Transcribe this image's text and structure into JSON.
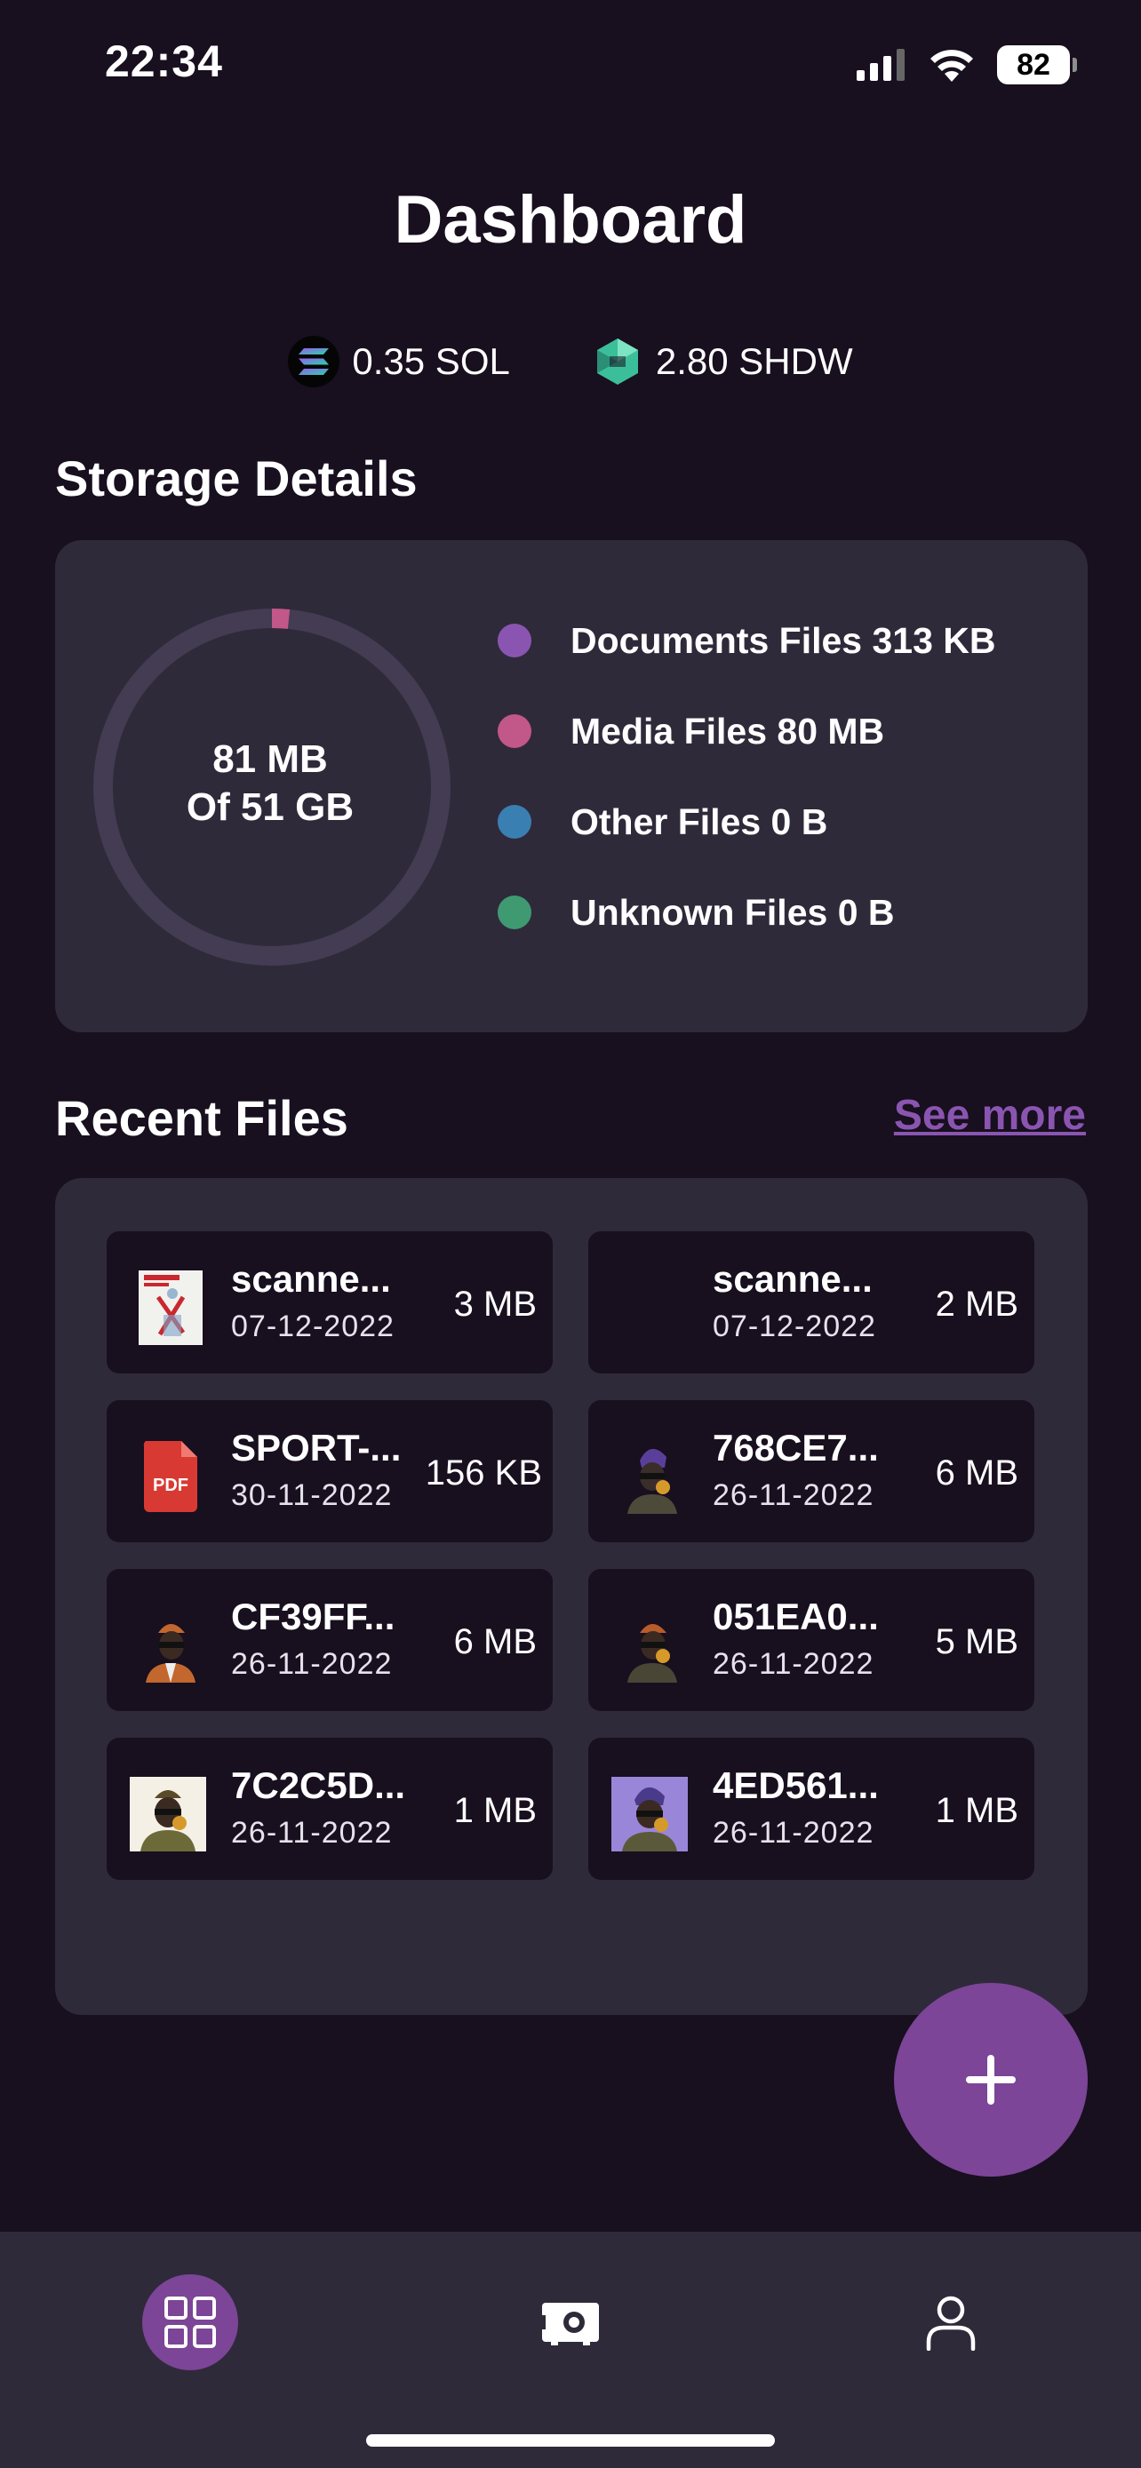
{
  "status_bar": {
    "time": "22:34",
    "battery": "82"
  },
  "header": {
    "title": "Dashboard"
  },
  "balances": [
    {
      "icon": "solana-coin-icon",
      "value": "0.35 SOL"
    },
    {
      "icon": "shadow-token-icon",
      "value": "2.80 SHDW"
    }
  ],
  "storage": {
    "heading": "Storage Details",
    "used": "81 MB",
    "total": "Of 51 GB",
    "used_fraction": 0.0016,
    "legend": [
      {
        "label": "Documents Files 313 KB",
        "color": "#8a55b1"
      },
      {
        "label": "Media Files 80 MB",
        "color": "#c2578a"
      },
      {
        "label": "Other Files 0 B",
        "color": "#3a7fb2"
      },
      {
        "label": "Unknown Files 0 B",
        "color": "#3f9a72"
      }
    ]
  },
  "recent": {
    "heading": "Recent Files",
    "see_more": "See more",
    "files": [
      {
        "name": "scanne...",
        "date": "07-12-2022",
        "size": "3 MB",
        "thumb": "magazine-thumbnail"
      },
      {
        "name": "scanne...",
        "date": "07-12-2022",
        "size": "2 MB",
        "thumb": "none"
      },
      {
        "name": "SPORT-...",
        "date": "30-11-2022",
        "size": "156 KB",
        "thumb": "pdf-icon"
      },
      {
        "name": "768CE7...",
        "date": "26-11-2022",
        "size": "6 MB",
        "thumb": "avatar-thumbnail"
      },
      {
        "name": "CF39FF...",
        "date": "26-11-2022",
        "size": "6 MB",
        "thumb": "avatar-thumbnail"
      },
      {
        "name": "051EA0...",
        "date": "26-11-2022",
        "size": "5 MB",
        "thumb": "avatar-thumbnail"
      },
      {
        "name": "7C2C5D...",
        "date": "26-11-2022",
        "size": "1 MB",
        "thumb": "avatar-thumbnail"
      },
      {
        "name": "4ED561...",
        "date": "26-11-2022",
        "size": "1 MB",
        "thumb": "avatar-thumbnail"
      }
    ]
  },
  "fab": {
    "icon": "plus-icon"
  },
  "tabbar": {
    "tabs": [
      {
        "icon": "dashboard-grid-icon",
        "active": true
      },
      {
        "icon": "storage-drive-icon",
        "active": false
      },
      {
        "icon": "profile-icon",
        "active": false
      }
    ]
  }
}
